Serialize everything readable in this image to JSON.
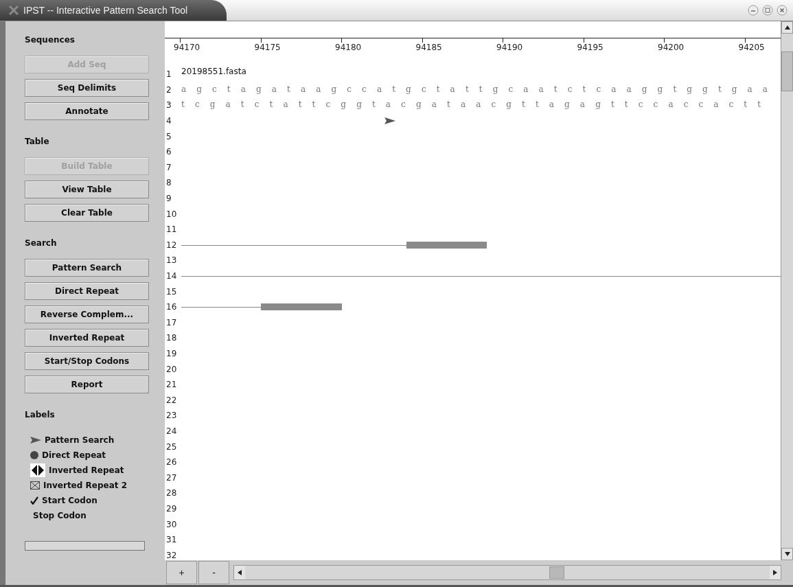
{
  "window": {
    "title": "IPST -- Interactive Pattern Search Tool"
  },
  "sidebar": {
    "sections": [
      {
        "heading": "Sequences",
        "buttons": [
          {
            "label": "Add Seq",
            "disabled": true
          },
          {
            "label": "Seq Delimits",
            "disabled": false
          },
          {
            "label": "Annotate",
            "disabled": false
          }
        ]
      },
      {
        "heading": "Table",
        "buttons": [
          {
            "label": "Build Table",
            "disabled": true
          },
          {
            "label": "View Table",
            "disabled": false
          },
          {
            "label": "Clear Table",
            "disabled": false
          }
        ]
      },
      {
        "heading": "Search",
        "buttons": [
          {
            "label": "Pattern Search",
            "disabled": false
          },
          {
            "label": "Direct Repeat",
            "disabled": false
          },
          {
            "label": "Reverse Complem...",
            "disabled": false
          },
          {
            "label": "Inverted Repeat",
            "disabled": false
          },
          {
            "label": "Start/Stop Codons",
            "disabled": false
          },
          {
            "label": "Report",
            "disabled": false
          }
        ]
      }
    ],
    "legend_heading": "Labels",
    "legend": [
      {
        "kind": "triangle",
        "label": "Pattern Search"
      },
      {
        "kind": "circle",
        "label": "Direct Repeat"
      },
      {
        "kind": "double-arrow",
        "label": "Inverted Repeat"
      },
      {
        "kind": "bowtie",
        "label": "Inverted Repeat 2"
      },
      {
        "kind": "check",
        "label": "Start Codon"
      },
      {
        "kind": "none",
        "label": "Stop Codon"
      }
    ],
    "progress": {
      "level": 0
    }
  },
  "ruler": {
    "ticks": [
      "94170",
      "94175",
      "94180",
      "94185",
      "94190",
      "94195",
      "94200",
      "94205"
    ]
  },
  "file_name": "20198551.fasta",
  "sequences": [
    "agctagataagccatgctattgcaatctcaaggtggtgaa",
    "tcgatctattcggtacgataacgttagagttccaccactt"
  ],
  "tracks": [
    {
      "label": "1"
    },
    {
      "label": "2"
    },
    {
      "label": "3"
    },
    {
      "label": "4",
      "features": [
        {
          "kind": "marker"
        }
      ]
    },
    {
      "label": "5"
    },
    {
      "label": "6"
    },
    {
      "label": "7"
    },
    {
      "label": "8"
    },
    {
      "label": "9"
    },
    {
      "label": "10"
    },
    {
      "label": "11"
    },
    {
      "label": "12",
      "features": [
        {
          "kind": "line"
        },
        {
          "kind": "bar"
        }
      ]
    },
    {
      "label": "13"
    },
    {
      "label": "14",
      "features": [
        {
          "kind": "line"
        }
      ]
    },
    {
      "label": "15"
    },
    {
      "label": "16",
      "features": [
        {
          "kind": "line"
        },
        {
          "kind": "bar"
        }
      ]
    },
    {
      "label": "17"
    },
    {
      "label": "18"
    },
    {
      "label": "19"
    },
    {
      "label": "20"
    },
    {
      "label": "21"
    },
    {
      "label": "22"
    },
    {
      "label": "23"
    },
    {
      "label": "24"
    },
    {
      "label": "25"
    },
    {
      "label": "26"
    },
    {
      "label": "27"
    },
    {
      "label": "28"
    },
    {
      "label": "29"
    },
    {
      "label": "30"
    },
    {
      "label": "31"
    },
    {
      "label": "32"
    }
  ],
  "zoom_buttons": [
    "+",
    "-"
  ]
}
